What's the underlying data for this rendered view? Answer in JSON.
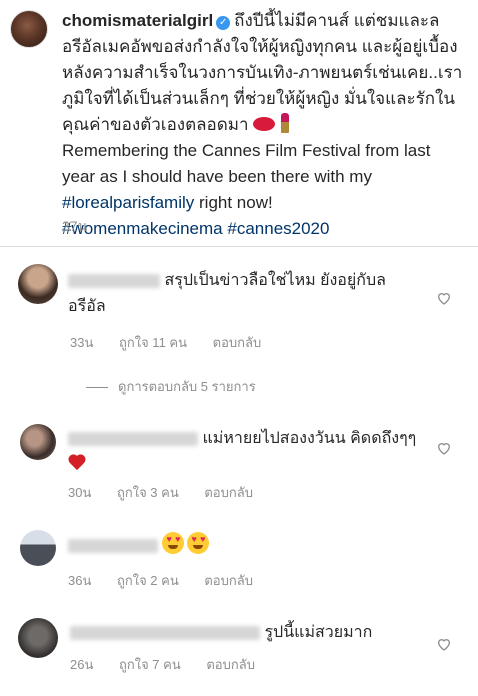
{
  "post": {
    "username": "chomismaterialgirl",
    "verified_icon": "verified-badge-icon",
    "caption_thai": "ถึงปีนี้ไม่มีคานส์ แต่ชมและลอรีอัลเมคอัพขอส่งกำลังใจให้ผู้หญิงทุกคน และผู้อยู่เบื้องหลังความสำเร็จในวงการบันเทิง-ภาพยนตร์เช่นเคย..เราภูมิใจที่ได้เป็นส่วนเล็กๆ ที่ช่วยให้ผู้หญิง มั่นใจและรักในคุณค่าของตัวเองตลอดมา",
    "caption_en": "Remembering the Cannes Film Festival from last year as I should have been there with my",
    "tag_lorealparisfamily": "#lorealparisfamily",
    "caption_en_tail": " right now!",
    "tag_women": "#womenmakecinema",
    "tag_cannes": "#cannes2020",
    "time": "37น"
  },
  "comments": [
    {
      "text": "สรุปเป็นข่าวลือใช่ไหม ยังอยู่กับลอรีอัล",
      "time": "33น",
      "likes": "ถูกใจ 11 คน",
      "reply": "ตอบกลับ"
    },
    {
      "text": "แม่หายยไปสองงวันน คิดดถึงๆๆ",
      "time": "30น",
      "likes": "ถูกใจ 3 คน",
      "reply": "ตอบกลับ"
    },
    {
      "text": "",
      "time": "36น",
      "likes": "ถูกใจ 2 คน",
      "reply": "ตอบกลับ"
    },
    {
      "text": "รูปนี้แม่สวยมาก",
      "time": "26น",
      "likes": "ถูกใจ 7 คน",
      "reply": "ตอบกลับ"
    }
  ],
  "view_replies": "ดูการตอบกลับ 5 รายการ",
  "icons": [
    "verified-badge-icon",
    "heart-outline-icon",
    "lips-emoji",
    "lipstick-emoji",
    "red-heart-emoji",
    "heart-eyes-emoji"
  ]
}
